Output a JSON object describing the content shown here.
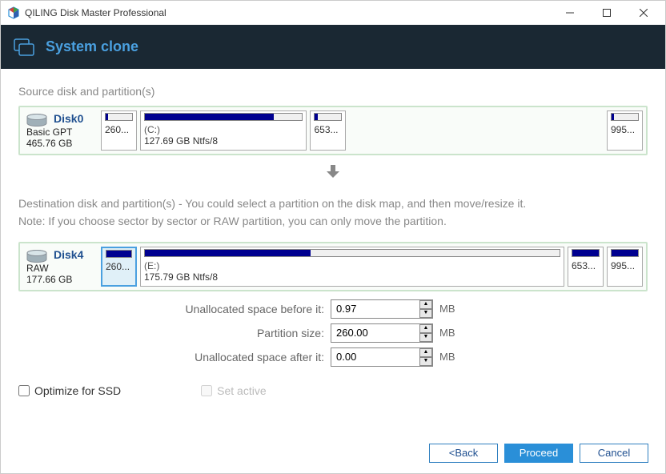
{
  "titlebar": {
    "title": "QILING Disk Master Professional"
  },
  "header": {
    "title": "System clone"
  },
  "source": {
    "label": "Source disk and partition(s)",
    "disk": {
      "name": "Disk0",
      "type": "Basic GPT",
      "size": "465.76 GB"
    },
    "parts": [
      {
        "label": "",
        "size": "260...",
        "fill": 10
      },
      {
        "label": "(C:)",
        "size": "127.69 GB Ntfs/8",
        "fill": 82
      },
      {
        "label": "",
        "size": "653...",
        "fill": 10
      },
      {
        "label": "",
        "size": "995...",
        "fill": 10
      }
    ]
  },
  "dest": {
    "label": "Destination disk and partition(s) - You could select a partition on the disk map, and then move/resize it.",
    "note": "Note: If you choose sector by sector or RAW partition, you can only move the partition.",
    "disk": {
      "name": "Disk4",
      "type": "RAW",
      "size": "177.66 GB"
    },
    "parts": [
      {
        "label": "",
        "size": "260...",
        "fill": 100,
        "selected": true
      },
      {
        "label": "(E:)",
        "size": "175.79 GB Ntfs/8",
        "fill": 40
      },
      {
        "label": "",
        "size": "653...",
        "fill": 100
      },
      {
        "label": "",
        "size": "995...",
        "fill": 100
      }
    ]
  },
  "form": {
    "before": {
      "label": "Unallocated space before it:",
      "value": "0.97",
      "unit": "MB"
    },
    "size": {
      "label": "Partition size:",
      "value": "260.00",
      "unit": "MB"
    },
    "after": {
      "label": "Unallocated space after it:",
      "value": "0.00",
      "unit": "MB"
    }
  },
  "checks": {
    "ssd": "Optimize for SSD",
    "active": "Set active"
  },
  "footer": {
    "back": "<Back",
    "proceed": "Proceed",
    "cancel": "Cancel"
  }
}
